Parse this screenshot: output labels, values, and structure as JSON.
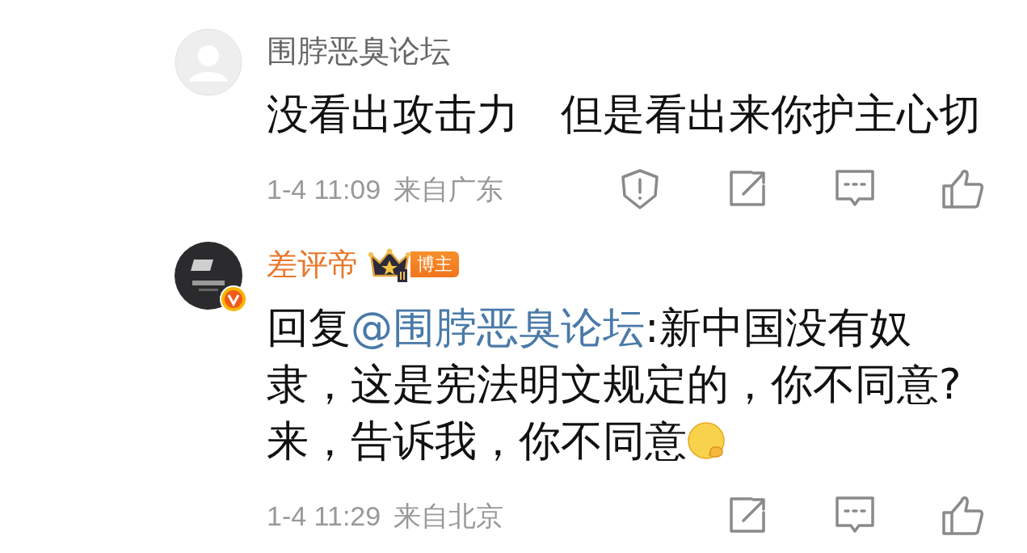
{
  "comments": [
    {
      "user": {
        "name": "围脖恶臭论坛",
        "avatar": {
          "kind": "default"
        },
        "vip": false,
        "verified": false
      },
      "text": "没看出攻击力　但是看出来你护主心切",
      "time": "1-4 11:09",
      "location": "来自广东",
      "actions": [
        {
          "kind": "report"
        },
        {
          "kind": "share"
        },
        {
          "kind": "comment"
        },
        {
          "kind": "like"
        }
      ]
    },
    {
      "user": {
        "name": "差评帝",
        "avatar": {
          "kind": "logo"
        },
        "vip": true,
        "verified": true,
        "badge": "博主"
      },
      "reply_prefix": "回复",
      "mention": "@围脖恶臭论坛",
      "text": ":新中国没有奴隶，这是宪法明文规定的，你不同意?来，告诉我，你不同意",
      "emoji": true,
      "time": "1-4 11:29",
      "location": "来自北京",
      "actions": [
        {
          "kind": "share"
        },
        {
          "kind": "comment"
        },
        {
          "kind": "like"
        }
      ]
    }
  ]
}
